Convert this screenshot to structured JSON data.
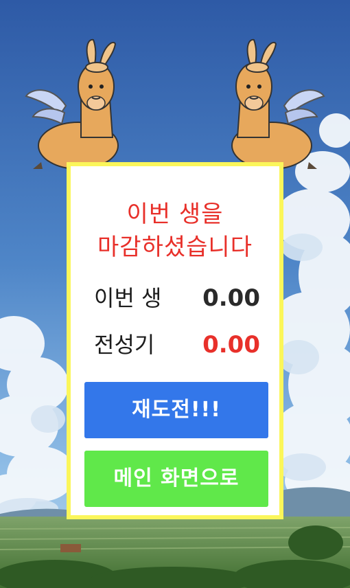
{
  "result": {
    "title_line1": "이번 생을",
    "title_line2": "마감하셨습니다",
    "current_label": "이번 생",
    "current_value": "0.00",
    "best_label": "전성기",
    "best_value": "0.00"
  },
  "buttons": {
    "retry_label": "재도전!!!",
    "main_label": "메인 화면으로"
  },
  "colors": {
    "title": "#e8302a",
    "best_value": "#e8302a",
    "retry_button": "#3377ea",
    "main_button": "#60e84a",
    "panel_border": "#fbf65a"
  },
  "background": {
    "icons": [
      "sky-background",
      "cloud-icon",
      "field-landscape",
      "winged-alpaca-icon"
    ]
  }
}
